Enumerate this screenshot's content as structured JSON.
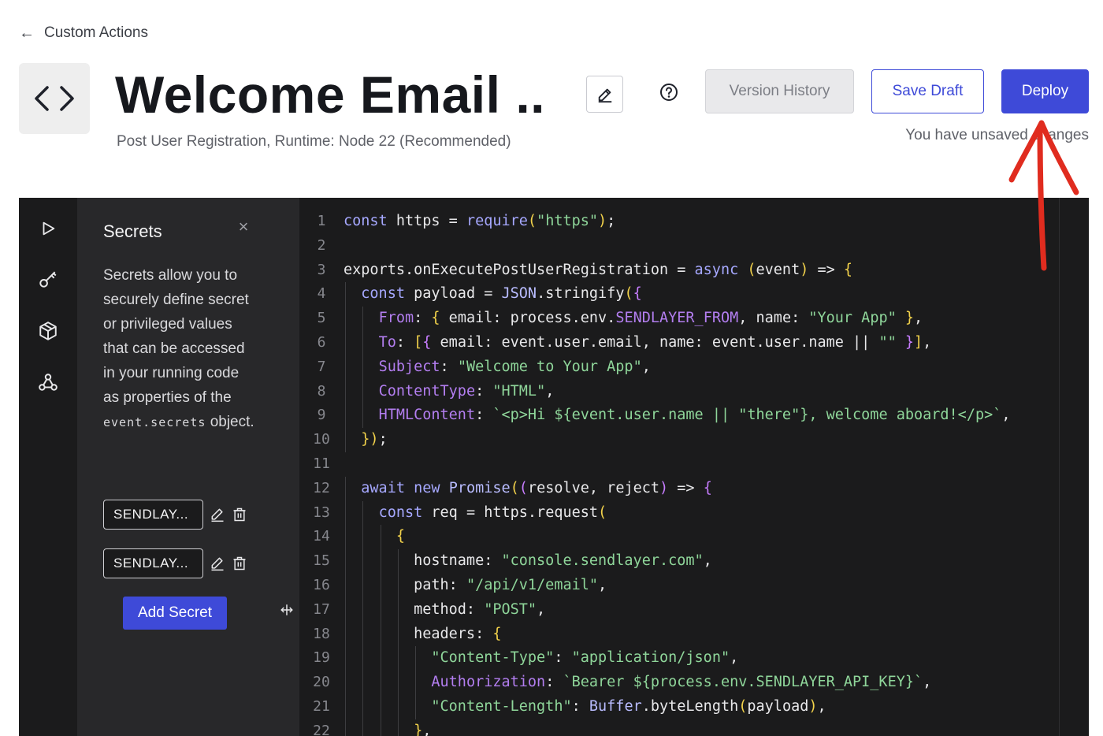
{
  "header": {
    "back_label": "Custom Actions",
    "title": "Welcome Email ...",
    "subtitle": "Post User Registration, Runtime: Node 22 (Recommended)",
    "version_history_label": "Version History",
    "save_draft_label": "Save Draft",
    "deploy_label": "Deploy",
    "unsaved_text": "You have unsaved changes"
  },
  "rail": {
    "items": [
      "play-icon",
      "key-icon",
      "package-icon",
      "webhook-icon"
    ]
  },
  "secrets": {
    "title": "Secrets",
    "description_before": "Secrets allow you to securely define secret or privileged values that can be accessed in your running code as properties of the",
    "description_code": "event.secrets",
    "description_after": "object.",
    "items": [
      "SENDLAY...",
      "SENDLAY..."
    ],
    "add_label": "Add Secret"
  },
  "editor": {
    "line_numbers": [
      "1",
      "2",
      "3",
      "4",
      "5",
      "6",
      "7",
      "8",
      "9",
      "10",
      "11",
      "12",
      "13",
      "14",
      "15",
      "16",
      "17",
      "18",
      "19",
      "20",
      "21",
      "22"
    ],
    "lines": [
      "const https = require(\"https\");",
      "",
      "exports.onExecutePostUserRegistration = async (event) => {",
      "  const payload = JSON.stringify({",
      "    From: { email: process.env.SENDLAYER_FROM, name: \"Your App\" },",
      "    To: [{ email: event.user.email, name: event.user.name || \"\" }],",
      "    Subject: \"Welcome to Your App\",",
      "    ContentType: \"HTML\",",
      "    HTMLContent: `<p>Hi ${event.user.name || \"there\"}, welcome aboard!</p>`,",
      "  });",
      "",
      "  await new Promise((resolve, reject) => {",
      "    const req = https.request(",
      "      {",
      "        hostname: \"console.sendlayer.com\",",
      "        path: \"/api/v1/email\",",
      "        method: \"POST\",",
      "        headers: {",
      "          \"Content-Type\": \"application/json\",",
      "          Authorization: `Bearer ${process.env.SENDLAYER_API_KEY}`,",
      "          \"Content-Length\": Buffer.byteLength(payload),",
      "        },"
    ]
  },
  "colors": {
    "accent": "#3e4ad8",
    "annotation_arrow": "#e02c1f",
    "editor_bg": "#1b1b1c",
    "panel_bg": "#28282a"
  }
}
